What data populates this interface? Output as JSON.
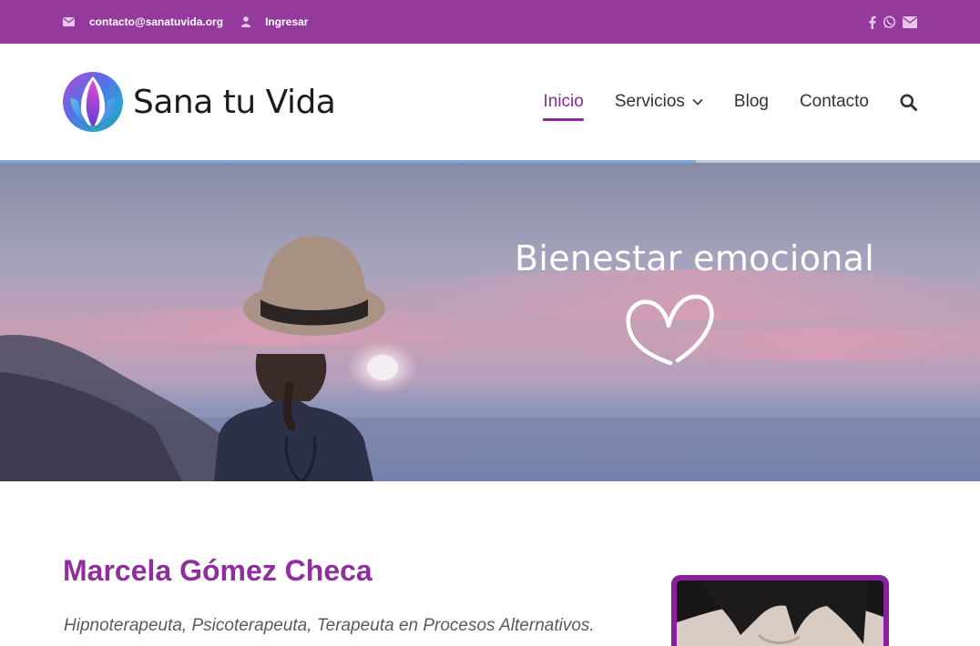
{
  "topbar": {
    "email": "contacto@sanatuvida.org",
    "login": "Ingresar",
    "social_icons": [
      "facebook-icon",
      "whatsapp-icon",
      "envelope-icon"
    ]
  },
  "header": {
    "brand": "Sana tu Vida",
    "nav": {
      "inicio": "Inicio",
      "servicios": "Servicios",
      "blog": "Blog",
      "contacto": "Contacto"
    },
    "active_item": "Inicio",
    "icons": [
      "chevron-down-icon",
      "search-icon"
    ]
  },
  "progress": {
    "fraction": 0.71
  },
  "hero": {
    "title": "Bienestar emocional",
    "icon": "heart-outline-icon"
  },
  "content": {
    "title": "Marcela Gómez Checa",
    "subtitle": "Hipnoterapeuta, Psicoterapeuta, Terapeuta en Procesos Alternativos."
  },
  "colors": {
    "topbar_bg": "#943a9c",
    "accent": "#8a2a96",
    "title_purple": "#8e2f9b",
    "portrait_border": "#8a1fa0"
  }
}
